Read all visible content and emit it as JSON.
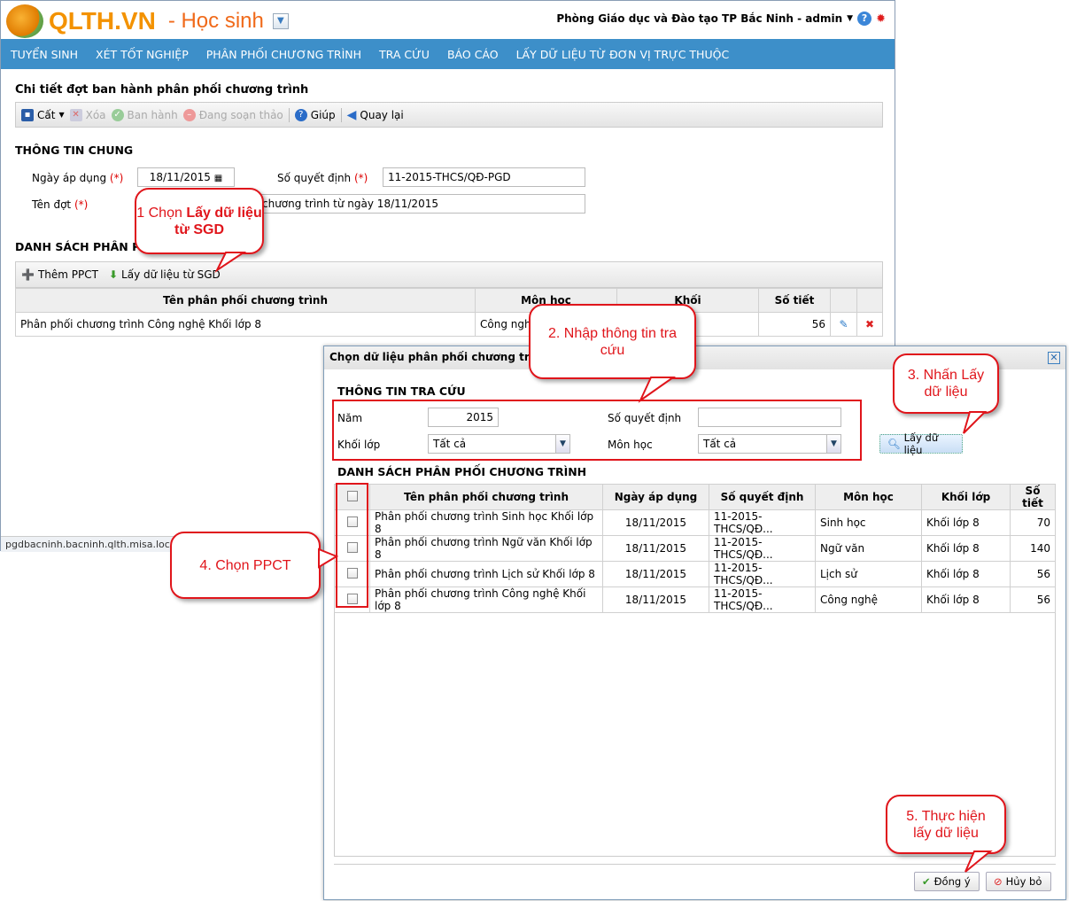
{
  "header": {
    "logo": "QLTH.VN",
    "module": "- Học sinh",
    "user": "Phòng Giáo dục và Đào tạo TP Bắc Ninh - admin"
  },
  "nav": [
    "TUYỂN SINH",
    "XÉT TỐT NGHIỆP",
    "PHÂN PHỐI CHƯƠNG TRÌNH",
    "TRA CỨU",
    "BÁO CÁO",
    "LẤY DỮ LIỆU TỪ ĐƠN VỊ TRỰC THUỘC"
  ],
  "page": {
    "title": "Chi tiết đợt ban hành phân phối chương trình",
    "toolbar": {
      "save": "Cất",
      "delete": "Xóa",
      "publish": "Ban hành",
      "draft": "Đang soạn thảo",
      "help": "Giúp",
      "back": "Quay lại"
    },
    "general": {
      "title": "THÔNG TIN CHUNG",
      "date_label": "Ngày áp dụng",
      "required": "(*)",
      "date_value": "18/11/2015",
      "decision_label": "Số quyết định",
      "decision_value": "11-2015-THCS/QĐ-PGD",
      "name_label": "Tên đợt",
      "name_value": "chương trình từ ngày 18/11/2015"
    },
    "list": {
      "title": "DANH SÁCH PHÂN PHỐI",
      "add": "Thêm PPCT",
      "fetch": "Lấy dữ liệu từ SGD",
      "columns": [
        "Tên phân phối chương trình",
        "Môn học",
        "Khối",
        "Số tiết"
      ],
      "rows": [
        {
          "name": "Phân phối chương trình Công nghệ Khối lớp 8",
          "subject": "Công nghệ",
          "grade": "",
          "periods": "56"
        }
      ]
    }
  },
  "status_bar": "pgdbacninh.bacninh.qlth.misa.loca",
  "dialog": {
    "title": "Chọn dữ liệu phân phối chương trình",
    "search": {
      "title": "THÔNG TIN TRA CỨU",
      "year_label": "Năm",
      "year_value": "2015",
      "decision_label": "Số quyết định",
      "decision_value": "",
      "grade_label": "Khối lớp",
      "grade_value": "Tất cả",
      "subject_label": "Môn học",
      "subject_value": "Tất cả",
      "fetch_button": "Lấy dữ liệu"
    },
    "list": {
      "title": "DANH SÁCH PHÂN PHỐI CHƯƠNG TRÌNH",
      "columns": [
        "Tên phân phối chương trình",
        "Ngày áp dụng",
        "Số quyết định",
        "Môn học",
        "Khối lớp",
        "Số tiết"
      ],
      "rows": [
        {
          "name": "Phân phối chương trình Sinh học Khối lớp 8",
          "date": "18/11/2015",
          "decision": "11-2015-THCS/QĐ...",
          "subject": "Sinh học",
          "grade": "Khối lớp 8",
          "periods": "70"
        },
        {
          "name": "Phân phối chương trình Ngữ văn Khối lớp 8",
          "date": "18/11/2015",
          "decision": "11-2015-THCS/QĐ...",
          "subject": "Ngữ văn",
          "grade": "Khối lớp 8",
          "periods": "140"
        },
        {
          "name": "Phân phối chương trình Lịch sử Khối lớp 8",
          "date": "18/11/2015",
          "decision": "11-2015-THCS/QĐ...",
          "subject": "Lịch sử",
          "grade": "Khối lớp 8",
          "periods": "56"
        },
        {
          "name": "Phân phối chương trình Công nghệ Khối lớp 8",
          "date": "18/11/2015",
          "decision": "11-2015-THCS/QĐ...",
          "subject": "Công nghệ",
          "grade": "Khối lớp 8",
          "periods": "56"
        }
      ]
    },
    "ok": "Đồng ý",
    "cancel": "Hủy bỏ"
  },
  "callouts": {
    "c1a": "1 Chọn ",
    "c1b": "Lấy dữ liệu từ SGD",
    "c2": "2. Nhập thông tin tra cứu",
    "c3": "3. Nhấn Lấy dữ liệu",
    "c4": "4. Chọn PPCT",
    "c5": "5. Thực hiện lấy dữ liệu"
  }
}
